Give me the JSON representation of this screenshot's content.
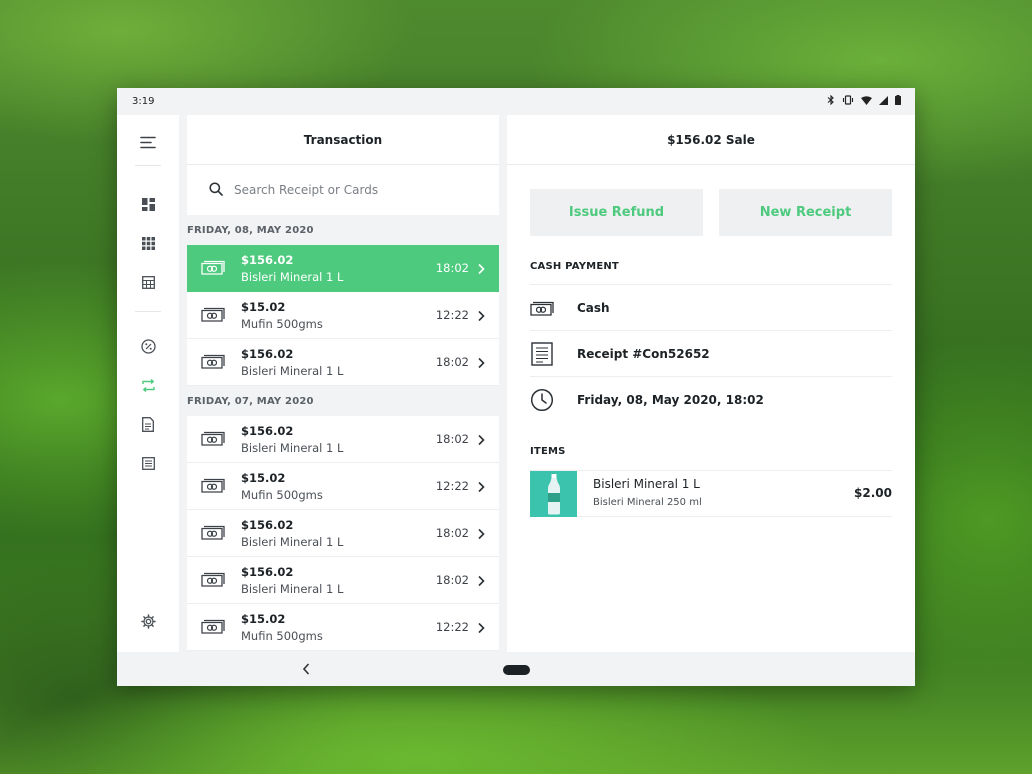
{
  "status_bar": {
    "time": "3:19",
    "icons": [
      "bluetooth-icon",
      "vibrate-icon",
      "wifi-icon",
      "signal-icon",
      "battery-icon"
    ]
  },
  "rail": {
    "icons": [
      "menu-icon",
      "dashboard-icon",
      "apps-grid-icon",
      "calculator-icon",
      "discount-icon",
      "transactions-icon",
      "document-icon",
      "report-icon",
      "settings-icon"
    ],
    "active": "transactions-icon"
  },
  "list": {
    "title": "Transaction",
    "search_placeholder": "Search Receipt or Cards",
    "groups": [
      {
        "date": "FRIDAY, 08, MAY 2020",
        "rows": [
          {
            "amount": "$156.02",
            "desc": "Bisleri Mineral 1 L",
            "time": "18:02",
            "active": true
          },
          {
            "amount": "$15.02",
            "desc": "Mufin 500gms",
            "time": "12:22",
            "active": false
          },
          {
            "amount": "$156.02",
            "desc": "Bisleri Mineral 1 L",
            "time": "18:02",
            "active": false
          }
        ]
      },
      {
        "date": "FRIDAY, 07, MAY 2020",
        "rows": [
          {
            "amount": "$156.02",
            "desc": "Bisleri Mineral 1 L",
            "time": "18:02",
            "active": false
          },
          {
            "amount": "$15.02",
            "desc": "Mufin 500gms",
            "time": "12:22",
            "active": false
          },
          {
            "amount": "$156.02",
            "desc": "Bisleri Mineral 1 L",
            "time": "18:02",
            "active": false
          },
          {
            "amount": "$156.02",
            "desc": "Bisleri Mineral 1 L",
            "time": "18:02",
            "active": false
          },
          {
            "amount": "$15.02",
            "desc": "Mufin 500gms",
            "time": "12:22",
            "active": false
          }
        ]
      }
    ]
  },
  "detail": {
    "title": "$156.02 Sale",
    "issue_refund_label": "Issue Refund",
    "new_receipt_label": "New Receipt",
    "payment_title": "CASH PAYMENT",
    "payment_method": "Cash",
    "receipt": "Receipt #Con52652",
    "datetime": "Friday, 08, May 2020, 18:02",
    "items_title": "ITEMS",
    "item": {
      "name": "Bisleri Mineral 1 L",
      "sub": "Bisleri Mineral 250 ml",
      "price": "$2.00"
    }
  },
  "colors": {
    "accent": "#4dca7e",
    "panel_bg": "#f2f3f4",
    "text_dark": "#1d2226",
    "thumb_bg": "#3cc3ae"
  }
}
